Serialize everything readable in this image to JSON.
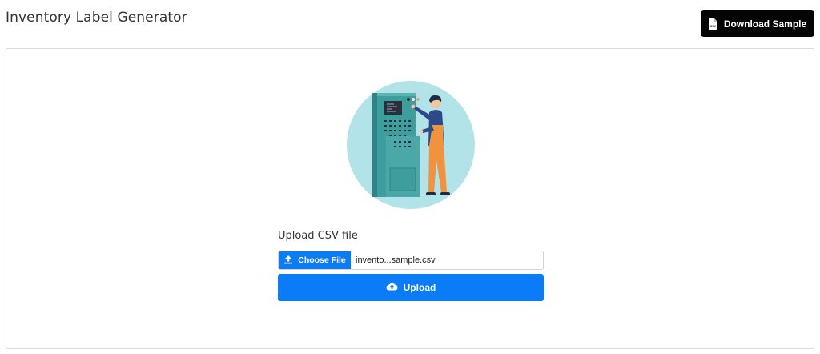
{
  "header": {
    "title": "Inventory Label Generator",
    "download_label": "Download Sample",
    "download_icon": "csv-file-icon"
  },
  "main": {
    "illustration": "operator-control-panel-illustration",
    "upload_label": "Upload CSV file",
    "file_input": {
      "button_label": "Choose File",
      "button_icon": "upload-icon",
      "file_name": "invento...sample.csv"
    },
    "upload_button": {
      "label": "Upload",
      "icon": "cloud-upload-icon"
    }
  },
  "colors": {
    "primary": "#0a7cf7",
    "dark_button": "#050505",
    "illustration_circle": "#b2e3e8",
    "machine": "#3e9e9e"
  }
}
